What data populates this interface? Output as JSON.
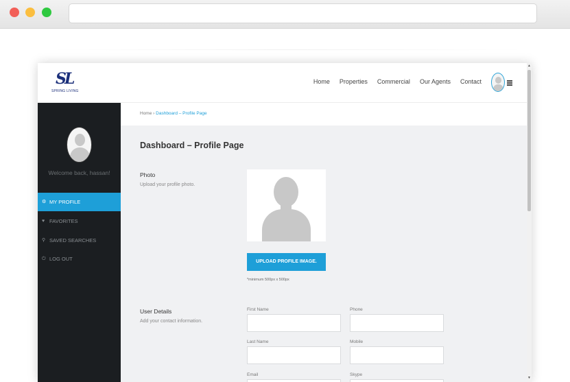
{
  "nav": {
    "items": [
      "Home",
      "Properties",
      "Commercial",
      "Our Agents",
      "Contact"
    ]
  },
  "logo": {
    "mark": "SL",
    "text": "SPRING LIVING"
  },
  "sidebar": {
    "welcome": "Welcome back, hassan!",
    "items": [
      {
        "label": "MY PROFILE",
        "icon": "gear-icon",
        "active": true
      },
      {
        "label": "FAVORITES",
        "icon": "heart-icon",
        "active": false
      },
      {
        "label": "SAVED SEARCHES",
        "icon": "search-icon",
        "active": false
      },
      {
        "label": "LOG OUT",
        "icon": "power-icon",
        "active": false
      }
    ]
  },
  "breadcrumb": {
    "home": "Home",
    "separator": "›",
    "current": "Dashboard – Profile Page"
  },
  "page": {
    "title": "Dashboard – Profile Page",
    "photo": {
      "title": "Photo",
      "subtitle": "Upload your profile photo.",
      "button": "UPLOAD PROFILE IMAGE.",
      "hint": "*minimum 500px x 500px"
    },
    "details": {
      "title": "User Details",
      "subtitle": "Add your contact information.",
      "fields": {
        "first_name": "First Name",
        "phone": "Phone",
        "last_name": "Last Name",
        "mobile": "Mobile",
        "email": "Email",
        "skype": "Skype"
      }
    }
  },
  "colors": {
    "accent": "#1e9fd8",
    "sidebar_bg": "#1b1e21",
    "brand": "#1b2f7a"
  }
}
